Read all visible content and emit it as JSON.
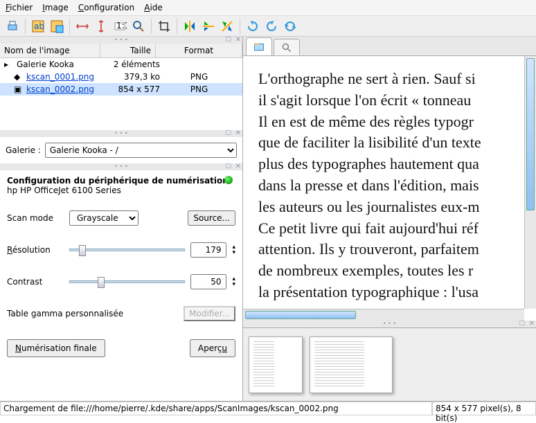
{
  "menu": {
    "file": "Fichier",
    "image": "Image",
    "config": "Configuration",
    "help": "Aide"
  },
  "gallery_tree": {
    "headers": {
      "name": "Nom de l'image",
      "size": "Taille",
      "format": "Format"
    },
    "root": {
      "name": "Galerie Kooka",
      "size": "2 éléments",
      "format": ""
    },
    "rows": [
      {
        "name": "kscan_0001.png",
        "size": "379,3 ko",
        "format": "PNG"
      },
      {
        "name": "kscan_0002.png",
        "size": "854 x 577",
        "format": "PNG"
      }
    ],
    "selected_index": 1
  },
  "gallery_combo": {
    "label": "Galerie :",
    "value": "Galerie Kooka - /"
  },
  "scan": {
    "title": "Configuration du périphérique de numérisation",
    "device": "hp HP OfficeJet 6100 Series",
    "mode_label": "Scan mode",
    "mode_value": "Grayscale",
    "source_btn": "Source...",
    "resolution_label": "Résolution",
    "resolution_value": "179",
    "contrast_label": "Contrast",
    "contrast_value": "50",
    "gamma_label": "Table gamma personnalisée",
    "gamma_btn": "Modifier...",
    "final_btn": "Numérisation finale",
    "preview_btn": "Aperçu"
  },
  "preview_text": "L'orthographe ne sert à rien. Sauf si\nil s'agit lorsque l'on écrit « tonneau\nIl en est de même des règles typogr\nque de faciliter la lisibilité d'un texte\nplus des typographes hautement qua\ndans la presse et dans l'édition, mais\nles auteurs ou les journalistes eux-m\nCe petit livre qui fait aujourd'hui réf\nattention. Ils y trouveront, parfaitem\nde nombreux exemples, toutes les r\nla présentation typographique : l'usa",
  "status": {
    "main": "Chargement de file:///home/pierre/.kde/share/apps/ScanImages/kscan_0002.png",
    "info": "854 x 577 pixel(s), 8 bit(s)"
  }
}
